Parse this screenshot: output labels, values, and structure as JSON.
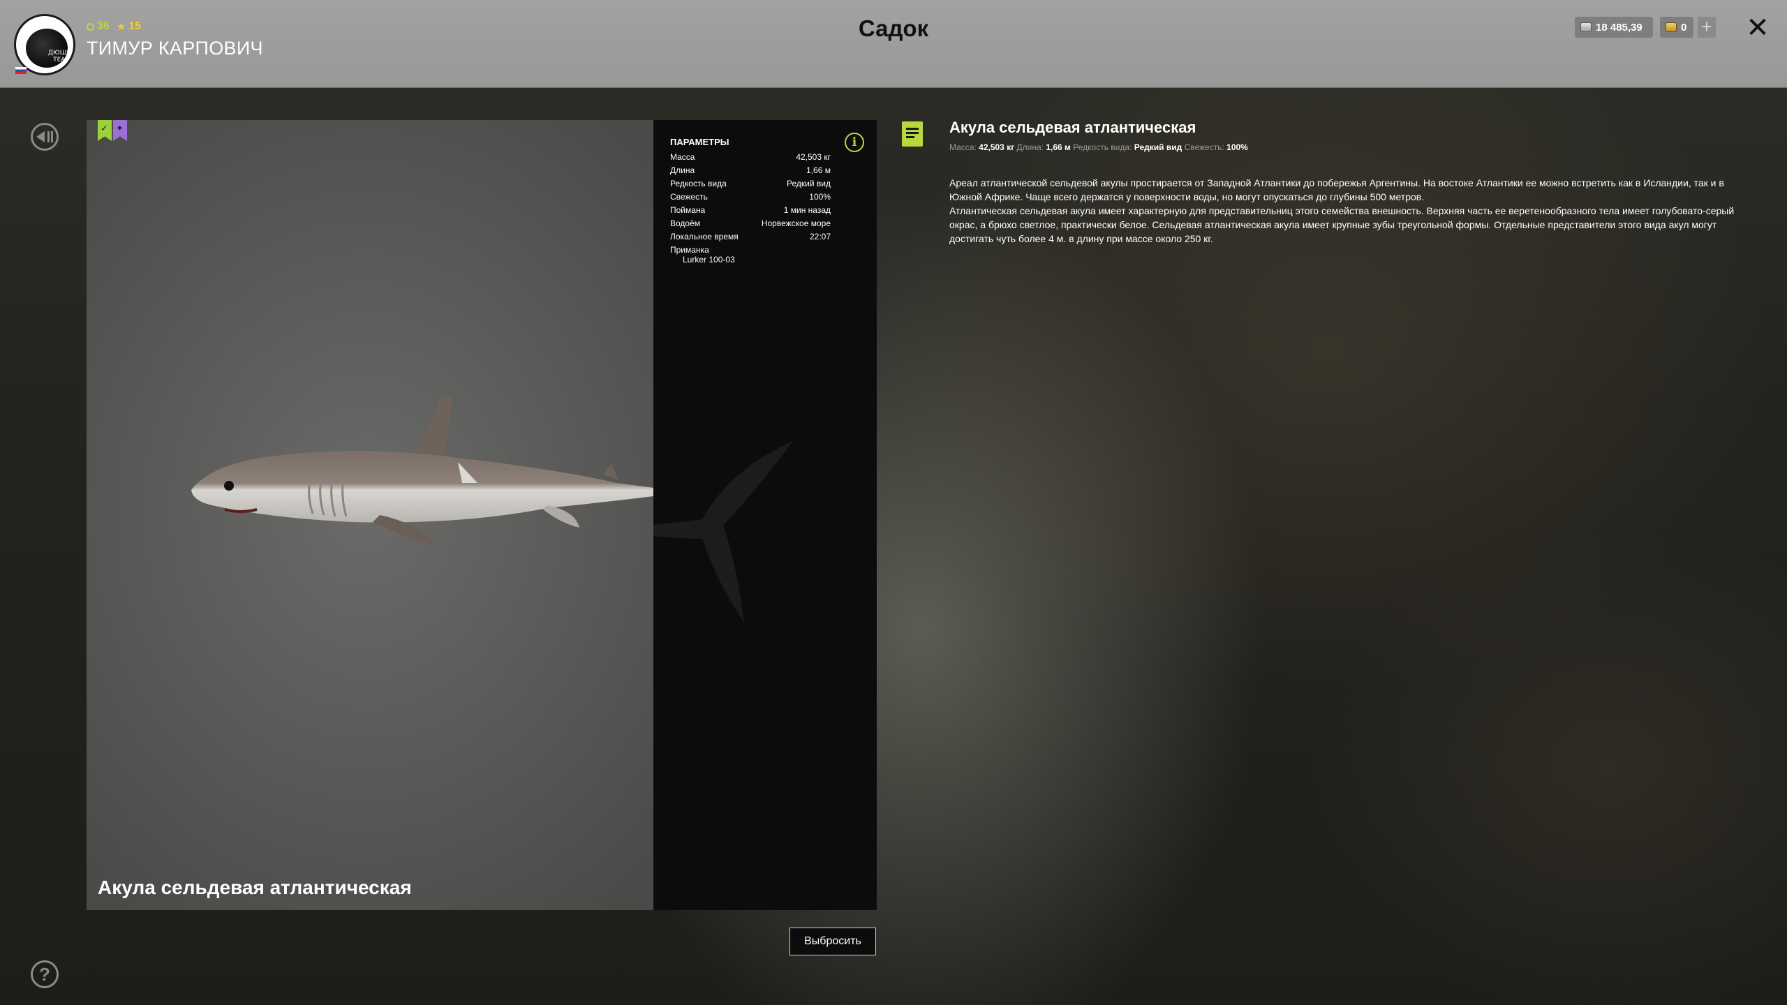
{
  "header": {
    "player": {
      "level": "36",
      "rating": "15",
      "name": "ТИМУР КАРПОВИЧ",
      "avatar_text": "ДЮШИЯ TEAM"
    },
    "title": "Садок",
    "currency": {
      "silver": "18 485,39",
      "gold": "0",
      "add_label": "+"
    },
    "close_label": "✕"
  },
  "sidebar": {
    "help_label": "?"
  },
  "fish": {
    "name": "Акула сельдевая атлантическая"
  },
  "params": {
    "title": "ПАРАМЕТРЫ",
    "info_label": "i",
    "rows": [
      {
        "label": "Масса",
        "value": "42,503 кг"
      },
      {
        "label": "Длина",
        "value": "1,66 м"
      },
      {
        "label": "Редкость вида",
        "value": "Редкий вид"
      },
      {
        "label": "Свежесть",
        "value": "100%"
      },
      {
        "label": "Поймана",
        "value": "1 мин назад"
      },
      {
        "label": "Водоём",
        "value": "Норвежское море"
      },
      {
        "label": "Локальное время",
        "value": "22:07"
      }
    ],
    "bait_label": "Приманка",
    "bait_value": "Lurker 100-03"
  },
  "release_button": "Выбросить",
  "description": {
    "title": "Акула сельдевая атлантическая",
    "meta": {
      "mass_label": "Масса:",
      "mass_value": "42,503 кг",
      "length_label": "Длина:",
      "length_value": "1,66 м",
      "rarity_label": "Редкость вида:",
      "rarity_value": "Редкий вид",
      "fresh_label": "Свежесть:",
      "fresh_value": "100%"
    },
    "paragraph1": "Ареал атлантической сельдевой акулы простирается от Западной Атлантики до побережья Аргентины. На востоке Атлантики ее можно встретить как в Исландии, так и в Южной Африке. Чаще всего держатся у поверхности воды, но могут опускаться до глубины 500 метров.",
    "paragraph2": "Атлантическая сельдевая акула имеет характерную для представительниц этого семейства внешность. Верхняя часть ее веретенообразного тела имеет голубовато-серый окрас, а брюхо светлое, практически белое. Сельдевая атлантическая акула имеет крупные зубы треугольной формы. Отдельные представители этого вида акул могут достигать чуть более 4 м. в длину при массе около 250 кг."
  },
  "colors": {
    "accent_green": "#b8d840",
    "accent_purple": "#9a70d8",
    "header_bg": "#9d9d9b",
    "panel_bg": "#0c0c0c"
  },
  "icons": {
    "back": "back-icon",
    "help": "help-icon",
    "info": "info-icon",
    "document": "document-icon",
    "close": "close-icon"
  }
}
